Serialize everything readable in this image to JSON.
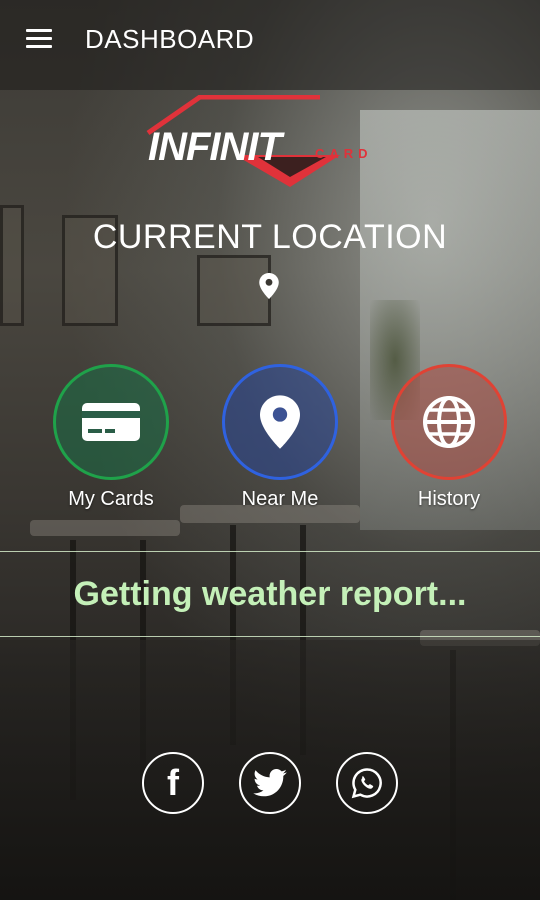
{
  "header": {
    "title": "DASHBOARD",
    "menu_icon": "hamburger-icon"
  },
  "logo": {
    "word": "INFINIT",
    "sub": "CARD",
    "accent_color": "#e0323a"
  },
  "location": {
    "title": "CURRENT LOCATION",
    "icon": "map-pin-icon"
  },
  "actions": [
    {
      "label": "My Cards",
      "icon": "credit-card-icon",
      "ring_color": "#1fa24a",
      "fill_color": "rgba(26,110,70,0.55)"
    },
    {
      "label": "Near Me",
      "icon": "map-pin-icon",
      "ring_color": "#2f62e0",
      "fill_color": "rgba(40,70,150,0.55)"
    },
    {
      "label": "History",
      "icon": "globe-icon",
      "ring_color": "#e04234",
      "fill_color": "rgba(170,75,65,0.55)"
    }
  ],
  "weather": {
    "status": "Getting weather report...",
    "text_color": "#c4f0b8"
  },
  "social": [
    {
      "icon": "facebook-icon",
      "glyph": "f"
    },
    {
      "icon": "twitter-icon"
    },
    {
      "icon": "whatsapp-icon"
    }
  ]
}
